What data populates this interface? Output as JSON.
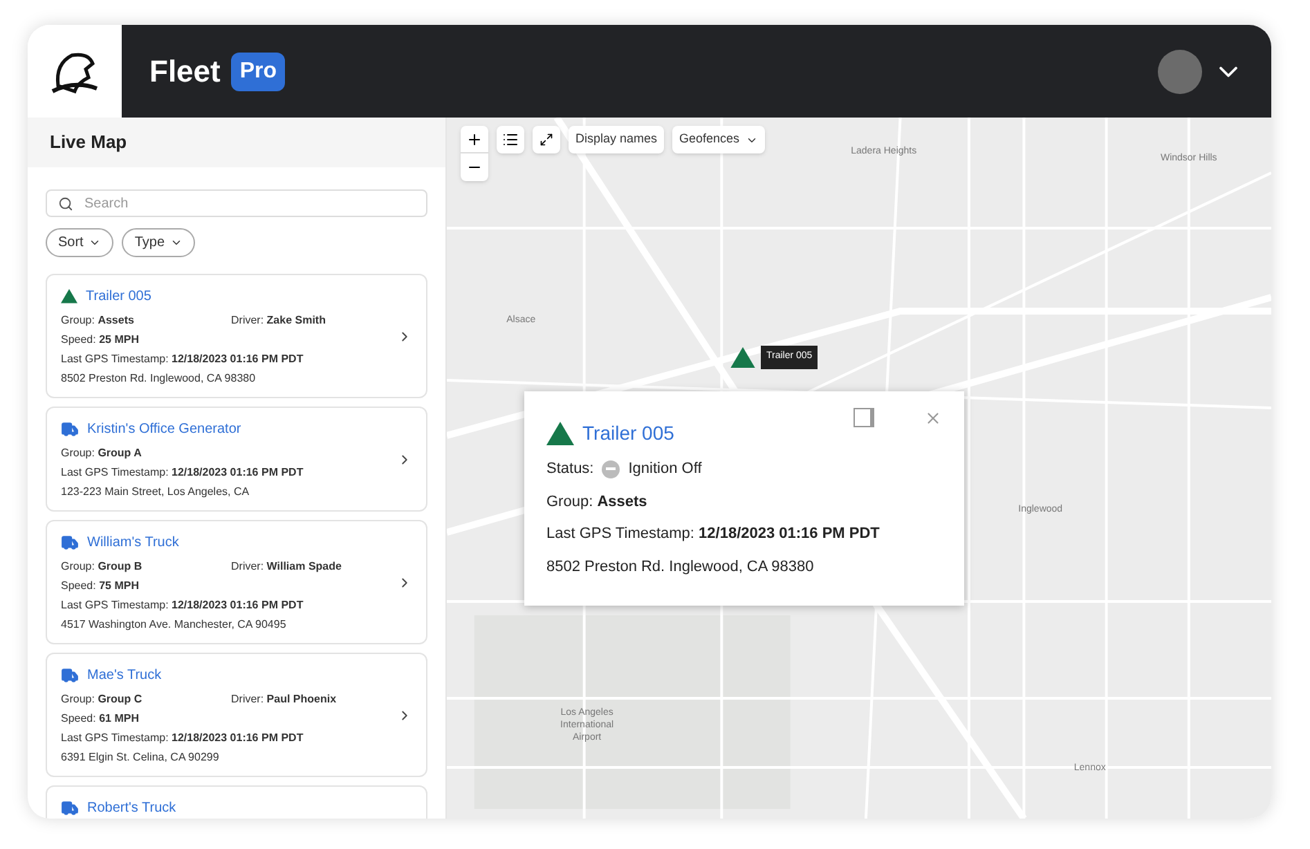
{
  "header": {
    "brand": "Fleet",
    "badge": "Pro"
  },
  "sidebar": {
    "title": "Live Map",
    "search": {
      "placeholder": "Search"
    },
    "filters": [
      "Sort",
      "Type"
    ],
    "vehicles": [
      {
        "kind": "trailer",
        "name": "Trailer 005",
        "lines": [
          [
            "Group: **Assets**",
            "Driver: **Zake Smith**"
          ],
          [
            "Speed: **25 MPH**"
          ],
          [
            "Last GPS Timestamp: **12/18/2023 01:16 PM PDT**"
          ],
          [
            "8502 Preston Rd. Inglewood, CA 98380"
          ]
        ]
      },
      {
        "kind": "truck",
        "name": "Kristin's Office Generator",
        "lines": [
          [
            "Group: **Group A**"
          ],
          [
            "Last GPS Timestamp: **12/18/2023 01:16 PM PDT**"
          ],
          [
            "123-223 Main Street, Los Angeles, CA"
          ]
        ]
      },
      {
        "kind": "truck",
        "name": "William's Truck",
        "lines": [
          [
            "Group: **Group B**",
            "Driver: **William Spade**"
          ],
          [
            "Speed: **75 MPH**"
          ],
          [
            "Last GPS Timestamp: **12/18/2023 01:16 PM PDT**"
          ],
          [
            "4517 Washington Ave. Manchester, CA 90495"
          ]
        ]
      },
      {
        "kind": "truck",
        "name": "Mae's Truck",
        "lines": [
          [
            "Group: **Group C**",
            "Driver: **Paul Phoenix**"
          ],
          [
            "Speed: **61 MPH**"
          ],
          [
            "Last GPS Timestamp: **12/18/2023 01:16 PM PDT**"
          ],
          [
            "6391 Elgin St. Celina, CA 90299"
          ]
        ]
      },
      {
        "kind": "truck",
        "name": "Robert's Truck"
      }
    ]
  },
  "map": {
    "toolbar": {
      "display_names": "Display names",
      "geofences": "Geofences"
    },
    "labels": [
      "Ladera Heights",
      "Windsor Hills",
      "Alsace",
      "Inglewood",
      "Los Angeles International Airport",
      "Lennox"
    ],
    "marker": {
      "label": "Trailer 005"
    },
    "popup": {
      "title": "Trailer 005",
      "status_label": "Status:",
      "status": "Ignition Off",
      "lines": [
        "Group: **Assets**",
        "Last GPS Timestamp: **12/18/2023 01:16 PM PDT**",
        "8502 Preston Rd. Inglewood, CA 98380"
      ]
    }
  }
}
